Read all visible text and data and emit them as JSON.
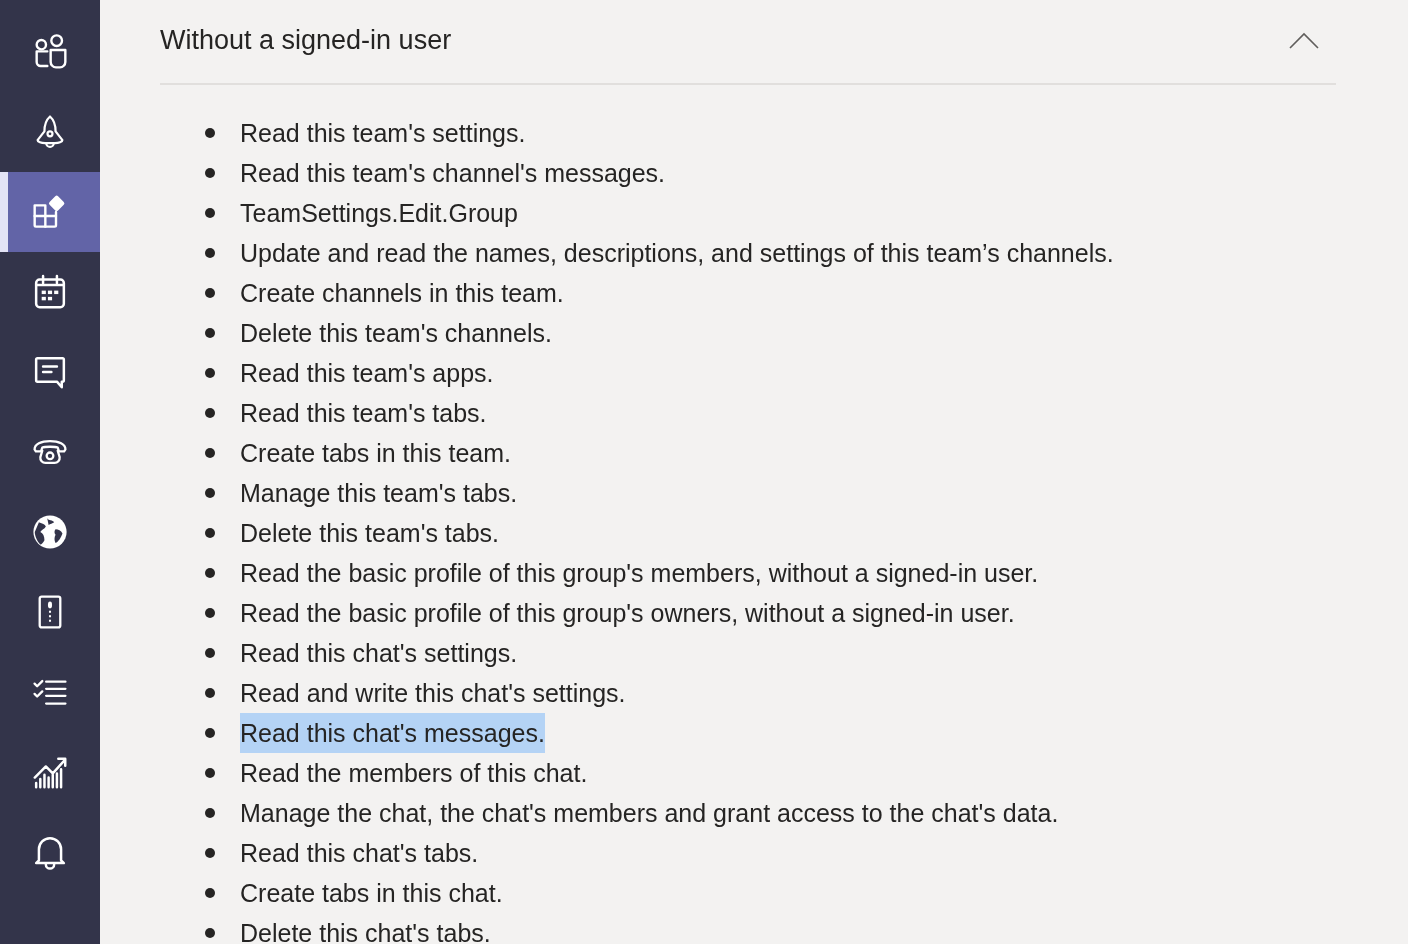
{
  "sidebar": {
    "items": [
      {
        "kind": "people",
        "selected": false
      },
      {
        "kind": "rocket",
        "selected": false
      },
      {
        "kind": "apps",
        "selected": true
      },
      {
        "kind": "calendar",
        "selected": false
      },
      {
        "kind": "chat",
        "selected": false
      },
      {
        "kind": "phone",
        "selected": false
      },
      {
        "kind": "globe",
        "selected": false
      },
      {
        "kind": "tablet",
        "selected": false
      },
      {
        "kind": "checklist",
        "selected": false
      },
      {
        "kind": "chart",
        "selected": false
      },
      {
        "kind": "bell",
        "selected": false
      }
    ]
  },
  "section": {
    "title": "Without a signed-in user",
    "expanded": true,
    "permissions": [
      {
        "text": "Read this team's settings.",
        "highlighted": false
      },
      {
        "text": "Read this team's channel's messages.",
        "highlighted": false
      },
      {
        "text": "TeamSettings.Edit.Group",
        "highlighted": false
      },
      {
        "text": "Update and read the names, descriptions, and settings of this team’s channels.",
        "highlighted": false
      },
      {
        "text": "Create channels in this team.",
        "highlighted": false
      },
      {
        "text": "Delete this team's channels.",
        "highlighted": false
      },
      {
        "text": "Read this team's apps.",
        "highlighted": false
      },
      {
        "text": "Read this team's tabs.",
        "highlighted": false
      },
      {
        "text": "Create tabs in this team.",
        "highlighted": false
      },
      {
        "text": "Manage this team's tabs.",
        "highlighted": false
      },
      {
        "text": "Delete this team's tabs.",
        "highlighted": false
      },
      {
        "text": "Read the basic profile of this group's members, without a signed-in user.",
        "highlighted": false
      },
      {
        "text": "Read the basic profile of this group's owners, without a signed-in user.",
        "highlighted": false
      },
      {
        "text": "Read this chat's settings.",
        "highlighted": false
      },
      {
        "text": "Read and write this chat's settings.",
        "highlighted": false
      },
      {
        "text": "Read this chat's messages.",
        "highlighted": true
      },
      {
        "text": "Read the members of this chat.",
        "highlighted": false
      },
      {
        "text": "Manage the chat, the chat's members and grant access to the chat's data.",
        "highlighted": false
      },
      {
        "text": "Read this chat's tabs.",
        "highlighted": false
      },
      {
        "text": "Create tabs in this chat.",
        "highlighted": false
      },
      {
        "text": "Delete this chat's tabs.",
        "highlighted": false
      }
    ]
  }
}
